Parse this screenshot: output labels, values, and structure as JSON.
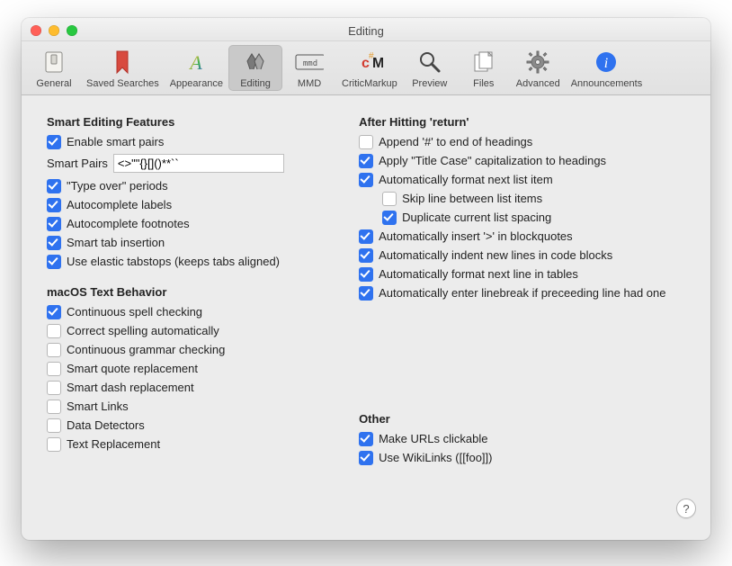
{
  "window": {
    "title": "Editing"
  },
  "toolbar": {
    "items": [
      {
        "id": "general",
        "label": "General"
      },
      {
        "id": "saved-searches",
        "label": "Saved Searches"
      },
      {
        "id": "appearance",
        "label": "Appearance"
      },
      {
        "id": "editing",
        "label": "Editing"
      },
      {
        "id": "mmd",
        "label": "MMD"
      },
      {
        "id": "criticmarkup",
        "label": "CriticMarkup"
      },
      {
        "id": "preview",
        "label": "Preview"
      },
      {
        "id": "files",
        "label": "Files"
      },
      {
        "id": "advanced",
        "label": "Advanced"
      },
      {
        "id": "announcements",
        "label": "Announcements"
      }
    ],
    "selected": "editing"
  },
  "sections": {
    "smart": {
      "title": "Smart Editing Features",
      "items": {
        "enable_smart_pairs": "Enable smart pairs",
        "smart_pairs_label": "Smart Pairs",
        "smart_pairs_value": "<>\"\"{}[]()**``",
        "type_over_periods": "\"Type over\" periods",
        "autocomplete_labels": "Autocomplete labels",
        "autocomplete_footnotes": "Autocomplete footnotes",
        "smart_tab": "Smart tab insertion",
        "elastic_tabstops": "Use elastic tabstops (keeps tabs aligned)"
      }
    },
    "macos": {
      "title": "macOS Text Behavior",
      "items": {
        "spellcheck": "Continuous spell checking",
        "autocorrect": "Correct spelling automatically",
        "grammar": "Continuous grammar checking",
        "smart_quotes": "Smart quote replacement",
        "smart_dashes": "Smart dash replacement",
        "smart_links": "Smart Links",
        "data_detectors": "Data Detectors",
        "text_replacement": "Text Replacement"
      }
    },
    "after_return": {
      "title": "After Hitting 'return'",
      "items": {
        "append_hash": "Append '#' to end of headings",
        "title_case": "Apply \"Title Case\" capitalization to headings",
        "format_list": "Automatically format next list item",
        "skip_line": "Skip line between list items",
        "dup_spacing": "Duplicate current list spacing",
        "insert_gt": "Automatically insert '>' in blockquotes",
        "indent_code": "Automatically indent new lines in code blocks",
        "format_table": "Automatically format next line in tables",
        "linebreak": "Automatically enter linebreak if preceeding line had one"
      }
    },
    "other": {
      "title": "Other",
      "items": {
        "urls_clickable": "Make URLs clickable",
        "wikilinks": "Use WikiLinks ([[foo]])"
      }
    }
  },
  "values": {
    "enable_smart_pairs": true,
    "type_over_periods": true,
    "autocomplete_labels": true,
    "autocomplete_footnotes": true,
    "smart_tab": true,
    "elastic_tabstops": true,
    "spellcheck": true,
    "autocorrect": false,
    "grammar": false,
    "smart_quotes": false,
    "smart_dashes": false,
    "smart_links": false,
    "data_detectors": false,
    "text_replacement": false,
    "append_hash": false,
    "title_case": true,
    "format_list": true,
    "skip_line": false,
    "dup_spacing": true,
    "insert_gt": true,
    "indent_code": true,
    "format_table": true,
    "linebreak": true,
    "urls_clickable": true,
    "wikilinks": true
  },
  "help_label": "?"
}
